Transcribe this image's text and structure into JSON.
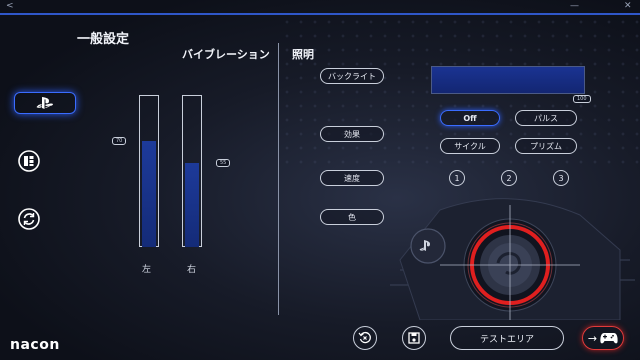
{
  "window": {
    "back_glyph": "<",
    "minimize_glyph": "—",
    "close_glyph": "✕"
  },
  "header": {
    "title": "一般設定"
  },
  "sidebar": {
    "items": [
      {
        "icon": "playstation-icon",
        "active": true
      },
      {
        "icon": "controller-layout-icon",
        "active": false
      },
      {
        "icon": "refresh-icon",
        "active": false
      }
    ]
  },
  "vibration": {
    "title": "バイブレーション",
    "left": {
      "label": "左",
      "value": 70,
      "tag": "70"
    },
    "right": {
      "label": "右",
      "value": 55,
      "tag": "55"
    }
  },
  "lighting": {
    "title": "照明",
    "rows": [
      {
        "label": "バックライト"
      },
      {
        "label": "効果"
      },
      {
        "label": "速度"
      },
      {
        "label": "色"
      }
    ],
    "backlight_level": 100,
    "backlight_tag": "100",
    "effects": [
      {
        "label": "Off",
        "selected": true
      },
      {
        "label": "パルス",
        "selected": false
      },
      {
        "label": "サイクル",
        "selected": false
      },
      {
        "label": "プリズム",
        "selected": false
      }
    ],
    "speeds": [
      "1",
      "2",
      "3"
    ],
    "accent_color": "#1c3a9e",
    "ring_color": "#e01f1f"
  },
  "footer": {
    "brand": "nacon",
    "test_area_label": "テストエリア",
    "next_arrow": "→",
    "next_icon": "gamepad-icon"
  }
}
